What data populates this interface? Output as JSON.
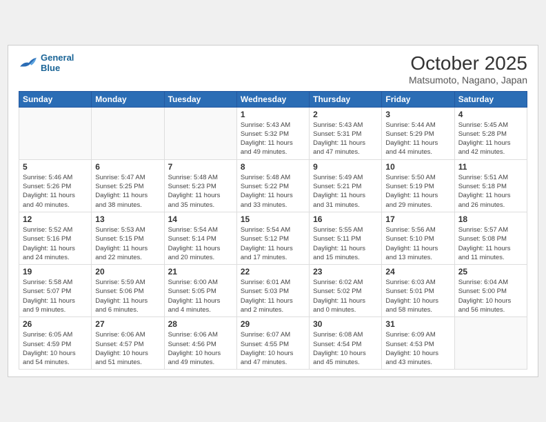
{
  "header": {
    "logo_line1": "General",
    "logo_line2": "Blue",
    "month": "October 2025",
    "location": "Matsumoto, Nagano, Japan"
  },
  "days_of_week": [
    "Sunday",
    "Monday",
    "Tuesday",
    "Wednesday",
    "Thursday",
    "Friday",
    "Saturday"
  ],
  "weeks": [
    [
      {
        "day": "",
        "sunrise": "",
        "sunset": "",
        "daylight": ""
      },
      {
        "day": "",
        "sunrise": "",
        "sunset": "",
        "daylight": ""
      },
      {
        "day": "",
        "sunrise": "",
        "sunset": "",
        "daylight": ""
      },
      {
        "day": "1",
        "sunrise": "Sunrise: 5:43 AM",
        "sunset": "Sunset: 5:32 PM",
        "daylight": "Daylight: 11 hours and 49 minutes."
      },
      {
        "day": "2",
        "sunrise": "Sunrise: 5:43 AM",
        "sunset": "Sunset: 5:31 PM",
        "daylight": "Daylight: 11 hours and 47 minutes."
      },
      {
        "day": "3",
        "sunrise": "Sunrise: 5:44 AM",
        "sunset": "Sunset: 5:29 PM",
        "daylight": "Daylight: 11 hours and 44 minutes."
      },
      {
        "day": "4",
        "sunrise": "Sunrise: 5:45 AM",
        "sunset": "Sunset: 5:28 PM",
        "daylight": "Daylight: 11 hours and 42 minutes."
      }
    ],
    [
      {
        "day": "5",
        "sunrise": "Sunrise: 5:46 AM",
        "sunset": "Sunset: 5:26 PM",
        "daylight": "Daylight: 11 hours and 40 minutes."
      },
      {
        "day": "6",
        "sunrise": "Sunrise: 5:47 AM",
        "sunset": "Sunset: 5:25 PM",
        "daylight": "Daylight: 11 hours and 38 minutes."
      },
      {
        "day": "7",
        "sunrise": "Sunrise: 5:48 AM",
        "sunset": "Sunset: 5:23 PM",
        "daylight": "Daylight: 11 hours and 35 minutes."
      },
      {
        "day": "8",
        "sunrise": "Sunrise: 5:48 AM",
        "sunset": "Sunset: 5:22 PM",
        "daylight": "Daylight: 11 hours and 33 minutes."
      },
      {
        "day": "9",
        "sunrise": "Sunrise: 5:49 AM",
        "sunset": "Sunset: 5:21 PM",
        "daylight": "Daylight: 11 hours and 31 minutes."
      },
      {
        "day": "10",
        "sunrise": "Sunrise: 5:50 AM",
        "sunset": "Sunset: 5:19 PM",
        "daylight": "Daylight: 11 hours and 29 minutes."
      },
      {
        "day": "11",
        "sunrise": "Sunrise: 5:51 AM",
        "sunset": "Sunset: 5:18 PM",
        "daylight": "Daylight: 11 hours and 26 minutes."
      }
    ],
    [
      {
        "day": "12",
        "sunrise": "Sunrise: 5:52 AM",
        "sunset": "Sunset: 5:16 PM",
        "daylight": "Daylight: 11 hours and 24 minutes."
      },
      {
        "day": "13",
        "sunrise": "Sunrise: 5:53 AM",
        "sunset": "Sunset: 5:15 PM",
        "daylight": "Daylight: 11 hours and 22 minutes."
      },
      {
        "day": "14",
        "sunrise": "Sunrise: 5:54 AM",
        "sunset": "Sunset: 5:14 PM",
        "daylight": "Daylight: 11 hours and 20 minutes."
      },
      {
        "day": "15",
        "sunrise": "Sunrise: 5:54 AM",
        "sunset": "Sunset: 5:12 PM",
        "daylight": "Daylight: 11 hours and 17 minutes."
      },
      {
        "day": "16",
        "sunrise": "Sunrise: 5:55 AM",
        "sunset": "Sunset: 5:11 PM",
        "daylight": "Daylight: 11 hours and 15 minutes."
      },
      {
        "day": "17",
        "sunrise": "Sunrise: 5:56 AM",
        "sunset": "Sunset: 5:10 PM",
        "daylight": "Daylight: 11 hours and 13 minutes."
      },
      {
        "day": "18",
        "sunrise": "Sunrise: 5:57 AM",
        "sunset": "Sunset: 5:08 PM",
        "daylight": "Daylight: 11 hours and 11 minutes."
      }
    ],
    [
      {
        "day": "19",
        "sunrise": "Sunrise: 5:58 AM",
        "sunset": "Sunset: 5:07 PM",
        "daylight": "Daylight: 11 hours and 9 minutes."
      },
      {
        "day": "20",
        "sunrise": "Sunrise: 5:59 AM",
        "sunset": "Sunset: 5:06 PM",
        "daylight": "Daylight: 11 hours and 6 minutes."
      },
      {
        "day": "21",
        "sunrise": "Sunrise: 6:00 AM",
        "sunset": "Sunset: 5:05 PM",
        "daylight": "Daylight: 11 hours and 4 minutes."
      },
      {
        "day": "22",
        "sunrise": "Sunrise: 6:01 AM",
        "sunset": "Sunset: 5:03 PM",
        "daylight": "Daylight: 11 hours and 2 minutes."
      },
      {
        "day": "23",
        "sunrise": "Sunrise: 6:02 AM",
        "sunset": "Sunset: 5:02 PM",
        "daylight": "Daylight: 11 hours and 0 minutes."
      },
      {
        "day": "24",
        "sunrise": "Sunrise: 6:03 AM",
        "sunset": "Sunset: 5:01 PM",
        "daylight": "Daylight: 10 hours and 58 minutes."
      },
      {
        "day": "25",
        "sunrise": "Sunrise: 6:04 AM",
        "sunset": "Sunset: 5:00 PM",
        "daylight": "Daylight: 10 hours and 56 minutes."
      }
    ],
    [
      {
        "day": "26",
        "sunrise": "Sunrise: 6:05 AM",
        "sunset": "Sunset: 4:59 PM",
        "daylight": "Daylight: 10 hours and 54 minutes."
      },
      {
        "day": "27",
        "sunrise": "Sunrise: 6:06 AM",
        "sunset": "Sunset: 4:57 PM",
        "daylight": "Daylight: 10 hours and 51 minutes."
      },
      {
        "day": "28",
        "sunrise": "Sunrise: 6:06 AM",
        "sunset": "Sunset: 4:56 PM",
        "daylight": "Daylight: 10 hours and 49 minutes."
      },
      {
        "day": "29",
        "sunrise": "Sunrise: 6:07 AM",
        "sunset": "Sunset: 4:55 PM",
        "daylight": "Daylight: 10 hours and 47 minutes."
      },
      {
        "day": "30",
        "sunrise": "Sunrise: 6:08 AM",
        "sunset": "Sunset: 4:54 PM",
        "daylight": "Daylight: 10 hours and 45 minutes."
      },
      {
        "day": "31",
        "sunrise": "Sunrise: 6:09 AM",
        "sunset": "Sunset: 4:53 PM",
        "daylight": "Daylight: 10 hours and 43 minutes."
      },
      {
        "day": "",
        "sunrise": "",
        "sunset": "",
        "daylight": ""
      }
    ]
  ]
}
